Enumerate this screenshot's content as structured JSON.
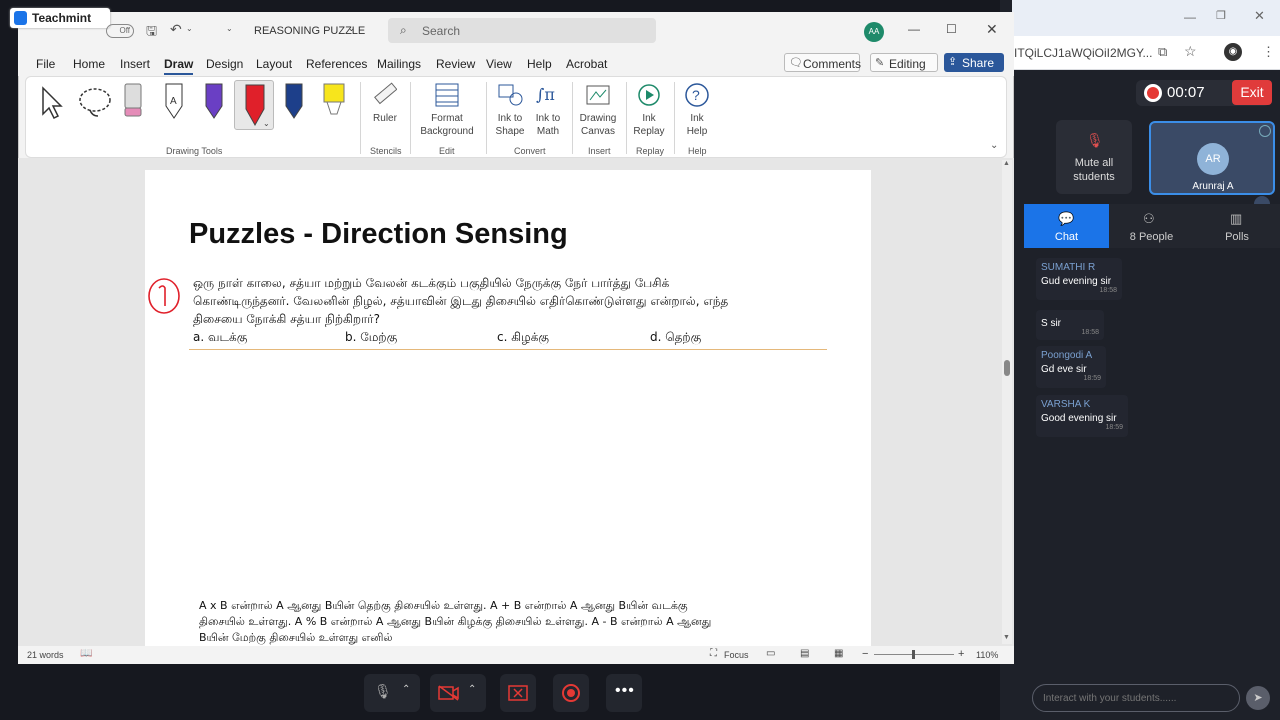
{
  "teachmint": {
    "logo": "Teachmint"
  },
  "word": {
    "autosave": "Off",
    "doc_title": "REASONING PUZZLE",
    "search_placeholder": "Search",
    "user_initials": "AA",
    "menu": [
      "File",
      "Home",
      "Insert",
      "Draw",
      "Design",
      "Layout",
      "References",
      "Mailings",
      "Review",
      "View",
      "Help",
      "Acrobat"
    ],
    "comments": "Comments",
    "editing": "Editing",
    "share": "Share",
    "ribbon": {
      "ruler": "Ruler",
      "format_background": [
        "Format",
        "Background"
      ],
      "ink_to_shape": [
        "Ink to",
        "Shape"
      ],
      "ink_to_math": [
        "Ink to",
        "Math"
      ],
      "drawing_canvas": [
        "Drawing",
        "Canvas"
      ],
      "ink_replay": [
        "Ink",
        "Replay"
      ],
      "ink_help": [
        "Ink",
        "Help"
      ],
      "groups": [
        "Drawing Tools",
        "Stencils",
        "Edit",
        "Convert",
        "Insert",
        "Replay",
        "Help"
      ]
    },
    "page": {
      "heading": "Puzzles - Direction Sensing",
      "question_line1": "ஒரு நாள் காலை, சத்யா மற்றும் வேலன் கடக்கும் பகுதியில் நேருக்கு நேர் பார்த்து பேசிக்",
      "question_line2": "கொண்டிருந்தனர். வேலனின் நிழல், சத்யாவின் இடது திசையில் எதிர்கொண்டுள்ளது என்றால், எந்த",
      "question_line3": "திசையை நோக்கி சத்யா நிற்கிறார்?",
      "options": [
        "a.  வடக்கு",
        "b.  மேற்கு",
        "c.  கிழக்கு",
        "d.  தெற்கு"
      ],
      "footer_line1": "A x B என்றால் A ஆனது Bயின் தெற்கு திசையில் உள்ளது. A + B என்றால் A ஆனது Bயின் வடக்கு",
      "footer_line2": "திசையில் உள்ளது. A % B என்றால் A ஆனது Bயின் கிழக்கு திசையில் உள்ளது. A - B என்றால் A ஆனது",
      "footer_line3": "Bயின் மேற்கு திசையில் உள்ளது எனில்"
    },
    "status": {
      "words": "21 words",
      "focus": "Focus",
      "zoom": "110%"
    }
  },
  "browser": {
    "url_fragment": "ITQiLCJ1aWQiOiI2MGY..."
  },
  "class": {
    "timer": "00:07",
    "exit": "Exit",
    "mute_all": [
      "Mute all",
      "students"
    ],
    "teacher_initials": "AR",
    "teacher_name": "Arunraj A",
    "tabs": [
      "Chat",
      "8 People",
      "Polls"
    ],
    "messages": [
      {
        "name": "SUMATHI R",
        "text": "Gud evening sir",
        "time": "18:58"
      },
      {
        "name": "",
        "text": "S sir",
        "time": "18:58"
      },
      {
        "name": "Poongodi A",
        "text": "Gd eve sir",
        "time": "18:59"
      },
      {
        "name": "VARSHA K",
        "text": "Good evening sir",
        "time": "18:59"
      }
    ],
    "chat_placeholder": "Interact with your students......"
  },
  "colors": {
    "accent_blue": "#1b74e8",
    "exit_red": "#e03b3b",
    "record_red": "#e53935",
    "word_blue": "#2b579a"
  }
}
